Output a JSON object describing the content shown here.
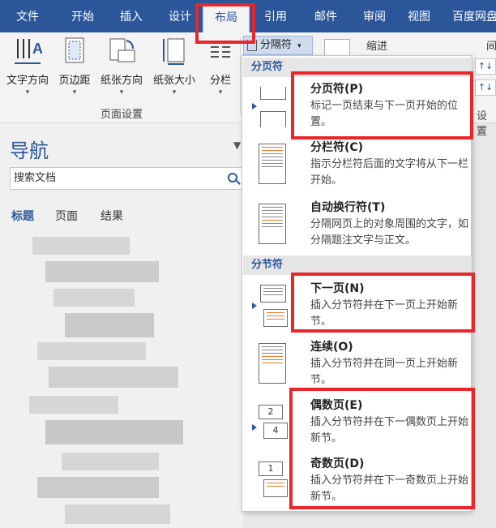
{
  "tabs": [
    "文件",
    "开始",
    "插入",
    "设计",
    "布局",
    "引用",
    "邮件",
    "审阅",
    "视图",
    "百度网盘"
  ],
  "active_tab": "布局",
  "ribbon": {
    "buttons": [
      "文字方向",
      "页边距",
      "纸张方向",
      "纸张大小",
      "分栏"
    ],
    "group_label": "页面设置",
    "separator_button": "分隔符",
    "indent_label": "缩进",
    "spacing_label": "间",
    "settings_label": "设置"
  },
  "nav": {
    "title": "导航",
    "search_placeholder": "搜索文档",
    "tabs": [
      "标题",
      "页面",
      "结果"
    ]
  },
  "menu": {
    "sections": [
      "分页符",
      "分节符"
    ],
    "items": [
      {
        "title": "分页符(P)",
        "desc": "标记一页结束与下一页开始的位置。"
      },
      {
        "title": "分栏符(C)",
        "desc": "指示分栏符后面的文字将从下一栏开始。"
      },
      {
        "title": "自动换行符(T)",
        "desc": "分隔网页上的对象周围的文字，如分隔题注文字与正文。"
      },
      {
        "title": "下一页(N)",
        "desc": "插入分节符并在下一页上开始新节。"
      },
      {
        "title": "连续(O)",
        "desc": "插入分节符并在同一页上开始新节。"
      },
      {
        "title": "偶数页(E)",
        "desc": "插入分节符并在下一偶数页上开始新节。"
      },
      {
        "title": "奇数页(D)",
        "desc": "插入分节符并在下一奇数页上开始新节。"
      }
    ]
  },
  "colors": {
    "accent": "#2b579a",
    "highlight": "#e8262b"
  }
}
